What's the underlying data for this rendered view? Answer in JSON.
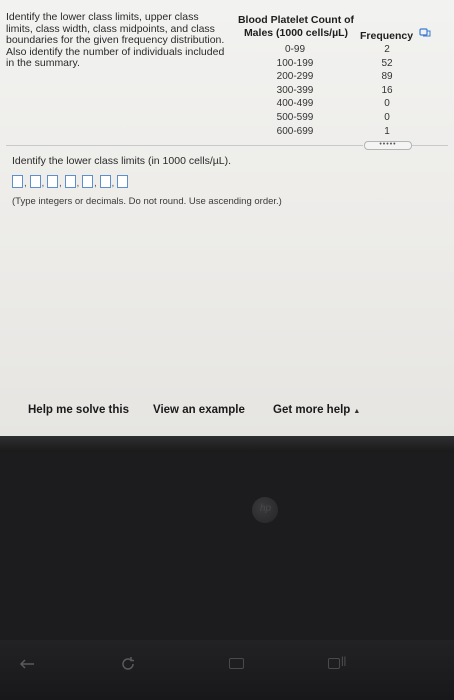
{
  "problem": {
    "lines": [
      "Identify the lower class limits, upper class",
      "limits, class width, class midpoints, and class",
      "boundaries for the given frequency distribution.",
      "Also identify the number of individuals included",
      "in the summary."
    ]
  },
  "table": {
    "header_col1_line1": "Blood Platelet Count of",
    "header_col1_line2": "Males (1000 cells/µL)",
    "header_col2": "Frequency",
    "rows": [
      {
        "range": "0-99",
        "freq": "2"
      },
      {
        "range": "100-199",
        "freq": "52"
      },
      {
        "range": "200-299",
        "freq": "89"
      },
      {
        "range": "300-399",
        "freq": "16"
      },
      {
        "range": "400-499",
        "freq": "0"
      },
      {
        "range": "500-599",
        "freq": "0"
      },
      {
        "range": "600-699",
        "freq": "1"
      }
    ],
    "copy_icon": "copy-icon"
  },
  "more_toggle": "•••••",
  "question": {
    "prompt": "Identify the lower class limits (in 1000 cells/µL).",
    "answer_box_count": 7,
    "separator": ",",
    "hint": "(Type integers or decimals. Do not round. Use ascending order.)"
  },
  "footer": {
    "help_label": "Help me solve this",
    "example_label": "View an example",
    "more_help_label": "Get more help",
    "more_help_caret": "▲"
  },
  "colors": {
    "answer_box_border": "#5e8ecb",
    "screen_bg": "#f2f2f0",
    "bezel": "#1c1c1e"
  }
}
